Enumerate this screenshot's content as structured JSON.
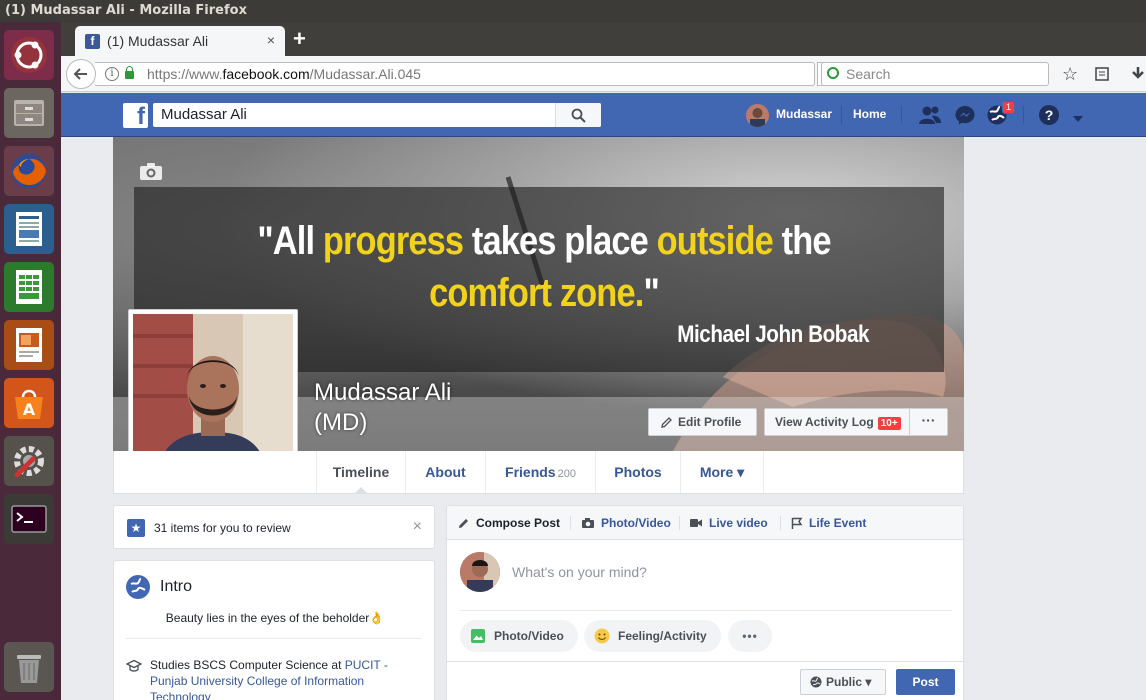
{
  "window": {
    "title": "(1) Mudassar Ali - Mozilla Firefox"
  },
  "launcher": {
    "items": [
      {
        "name": "ubuntu-dash-icon"
      },
      {
        "name": "files-icon"
      },
      {
        "name": "firefox-icon"
      },
      {
        "name": "writer-icon"
      },
      {
        "name": "calc-icon"
      },
      {
        "name": "impress-icon"
      },
      {
        "name": "software-center-icon"
      },
      {
        "name": "system-settings-icon"
      },
      {
        "name": "terminal-icon"
      },
      {
        "name": "trash-icon"
      }
    ]
  },
  "browser": {
    "tab_title": "(1) Mudassar Ali",
    "tab_close": "×",
    "new_tab": "+",
    "url_prefix": "https://www.",
    "url_host": "facebook.com",
    "url_path": "/Mudassar.Ali.045",
    "search_placeholder": "Search"
  },
  "fb": {
    "search_value": "Mudassar Ali",
    "user_name": "Mudassar",
    "home_label": "Home",
    "notification_count": "1"
  },
  "cover": {
    "quote_open": "\"All ",
    "quote_hl1": "progress",
    "quote_mid1": " takes place ",
    "quote_hl2": "outside",
    "quote_mid2": " the ",
    "quote_hl3": "comfort zone.",
    "quote_close": "\"",
    "author": "Michael John Bobak",
    "name_line1": "Mudassar Ali",
    "name_line2": "(MD)",
    "edit_profile": "Edit Profile",
    "view_activity_log": "View Activity Log",
    "activity_badge": "10+",
    "more_dots": "···"
  },
  "profile_nav": {
    "timeline": "Timeline",
    "about": "About",
    "friends": "Friends",
    "friends_count": "200",
    "photos": "Photos",
    "more": "More ▾"
  },
  "review": {
    "text": "31 items for you to review",
    "close": "×"
  },
  "intro": {
    "title": "Intro",
    "bio": "Beauty lies in the eyes of the beholder👌",
    "edu_prefix": "Studies BSCS Computer Science at ",
    "edu_link": "PUCIT - Punjab University College of Information Technology"
  },
  "composer": {
    "compose_post": "Compose Post",
    "photo_video": "Photo/Video",
    "live_video": "Live video",
    "life_event": "Life Event",
    "placeholder": "What's on your mind?",
    "pill_photo": "Photo/Video",
    "pill_feeling": "Feeling/Activity",
    "pill_more": "•••",
    "privacy": "Public ▾",
    "post": "Post"
  },
  "colors": {
    "fb_blue": "#4267b2",
    "link_blue": "#365899",
    "quote_yellow": "#f2d31b",
    "launcher_bg": "#4a2a3a"
  }
}
